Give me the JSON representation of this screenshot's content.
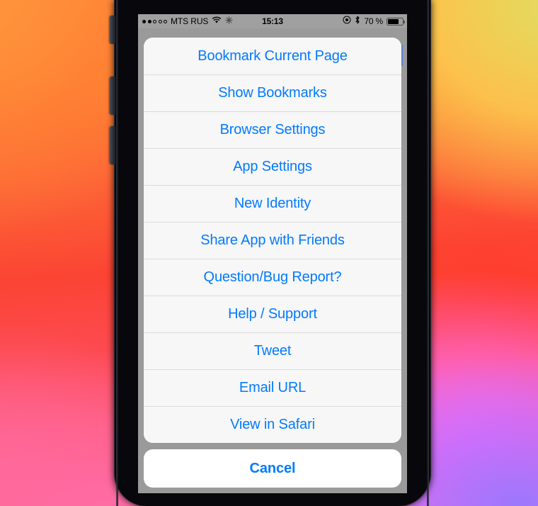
{
  "status_bar": {
    "signal_dots_total": 5,
    "signal_dots_filled": 2,
    "carrier": "MTS RUS",
    "wifi_icon": "wifi-icon",
    "snowflake_icon": "snowflake-icon",
    "time": "15:13",
    "location_icon": "location-arrow-icon",
    "bluetooth_icon": "bluetooth-icon",
    "battery_percent": "70 %",
    "battery_icon": "battery-icon",
    "battery_level": 70
  },
  "action_sheet": {
    "items": [
      {
        "label": "Bookmark Current Page",
        "name": "bookmark-current-page"
      },
      {
        "label": "Show Bookmarks",
        "name": "show-bookmarks"
      },
      {
        "label": "Browser Settings",
        "name": "browser-settings"
      },
      {
        "label": "App Settings",
        "name": "app-settings"
      },
      {
        "label": "New Identity",
        "name": "new-identity"
      },
      {
        "label": "Share App with Friends",
        "name": "share-app-with-friends"
      },
      {
        "label": "Question/Bug Report?",
        "name": "question-bug-report"
      },
      {
        "label": "Help / Support",
        "name": "help-support"
      },
      {
        "label": "Tweet",
        "name": "tweet"
      },
      {
        "label": "Email URL",
        "name": "email-url"
      },
      {
        "label": "View in Safari",
        "name": "view-in-safari"
      }
    ],
    "cancel_label": "Cancel"
  },
  "colors": {
    "accent_blue": "#027aff",
    "sheet_background": "#f7f7f7",
    "cancel_background": "#ffffff",
    "backdrop_gray": "#9a9a9a",
    "status_bar_gray": "#a0a0a0"
  }
}
